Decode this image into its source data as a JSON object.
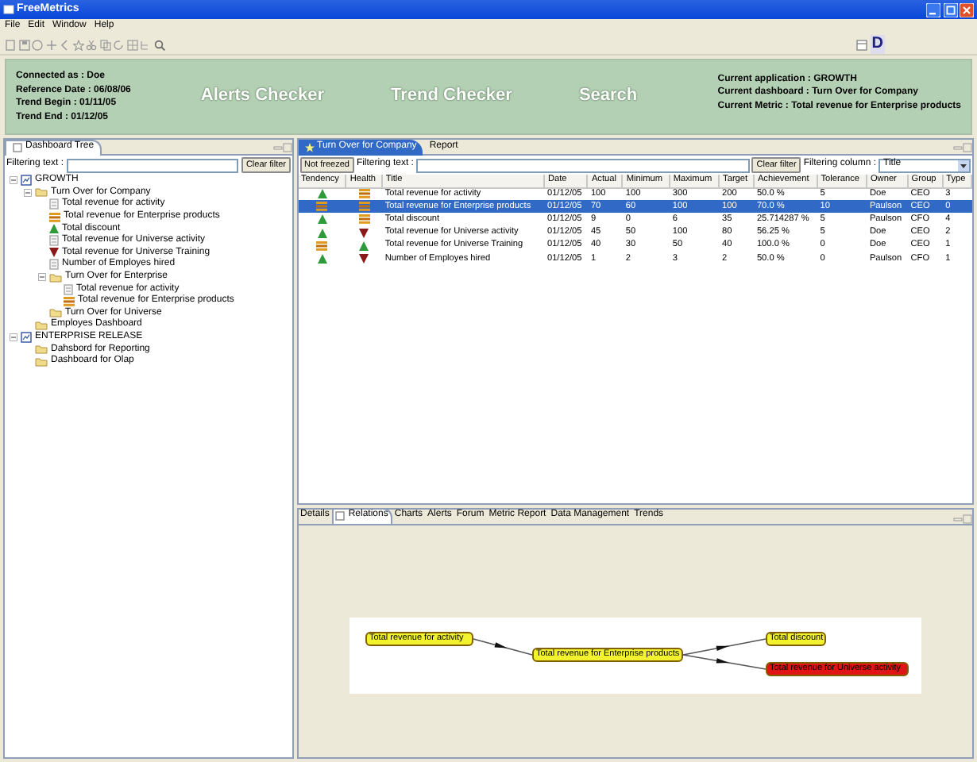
{
  "window": {
    "title": "FreeMetrics"
  },
  "menu": [
    "File",
    "Edit",
    "Window",
    "Help"
  ],
  "toolbar": {
    "logo": "D"
  },
  "header": {
    "info_left": [
      "Connected as : Doe",
      "Reference Date : 06/08/06",
      "Trend Begin : 01/11/05",
      "Trend End : 01/12/05"
    ],
    "links": [
      "Alerts Checker",
      "Trend Checker",
      "Search"
    ],
    "info_right": [
      "Current application : GROWTH",
      "Current dashboard : Turn Over for Company",
      "Current Metric : Total revenue for Enterprise products"
    ]
  },
  "tree_panel": {
    "title": "Dashboard Tree",
    "filter_label": "Filtering text :",
    "clear_button": "Clear filter",
    "items": [
      {
        "label": "GROWTH",
        "kind": "application",
        "expanded": true,
        "children": [
          {
            "label": "Turn Over for Company",
            "kind": "dashboard",
            "expanded": true,
            "children": [
              {
                "label": "Total revenue for activity",
                "kind": "report"
              },
              {
                "label": "Total revenue for Enterprise products",
                "kind": "bars"
              },
              {
                "label": "Total discount",
                "kind": "up"
              },
              {
                "label": "Total revenue for Universe activity",
                "kind": "report"
              },
              {
                "label": "Total revenue for Universe Training",
                "kind": "down"
              },
              {
                "label": "Number of Employes hired",
                "kind": "report"
              },
              {
                "label": "Turn Over for Enterprise",
                "kind": "dashboard",
                "expanded": true,
                "children": [
                  {
                    "label": "Total revenue for activity",
                    "kind": "report"
                  },
                  {
                    "label": "Total revenue for Enterprise products",
                    "kind": "bars"
                  }
                ]
              },
              {
                "label": "Turn Over for Universe",
                "kind": "dashboard"
              }
            ]
          },
          {
            "label": "Employes Dashboard",
            "kind": "dashboard"
          }
        ]
      },
      {
        "label": "ENTERPRISE RELEASE",
        "kind": "application",
        "expanded": true,
        "children": [
          {
            "label": "Dahsbord for Reporting",
            "kind": "dashboard"
          },
          {
            "label": "Dashboard for Olap",
            "kind": "dashboard"
          }
        ]
      }
    ]
  },
  "main_tabs": [
    {
      "label": "Turn Over for Company",
      "selected": true
    },
    {
      "label": "Report",
      "selected": false
    }
  ],
  "table_toolbar": {
    "freeze_button": "Not freezed",
    "filter_label": "Filtering text :",
    "clear_button": "Clear filter",
    "column_label": "Filtering column :",
    "column_value": "Title"
  },
  "table": {
    "icon_columns": [
      "Tendency",
      "Health"
    ],
    "columns": [
      "Title",
      "Date",
      "Actual",
      "Minimum",
      "Maximum",
      "Target",
      "Achievement",
      "Tolerance",
      "Owner",
      "Group",
      "Type"
    ],
    "rows": [
      {
        "tendency": {
          "kind": "up"
        },
        "health": {
          "kind": "bars"
        },
        "selected": false,
        "cells": [
          "Total revenue for activity",
          "01/12/05",
          "100",
          "100",
          "300",
          "200",
          "50.0 %",
          "5",
          "Doe",
          "CEO",
          "3"
        ]
      },
      {
        "tendency": {
          "kind": "bars"
        },
        "health": {
          "kind": "bars"
        },
        "selected": true,
        "cells": [
          "Total revenue for Enterprise products",
          "01/12/05",
          "70",
          "60",
          "100",
          "100",
          "70.0 %",
          "10",
          "Paulson",
          "CEO",
          "0"
        ]
      },
      {
        "tendency": {
          "kind": "up"
        },
        "health": {
          "kind": "bars"
        },
        "selected": false,
        "cells": [
          "Total discount",
          "01/12/05",
          "9",
          "0",
          "6",
          "35",
          "25.714287 %",
          "5",
          "Paulson",
          "CFO",
          "4"
        ]
      },
      {
        "tendency": {
          "kind": "up"
        },
        "health": {
          "kind": "down"
        },
        "selected": false,
        "cells": [
          "Total revenue for Universe activity",
          "01/12/05",
          "45",
          "50",
          "100",
          "80",
          "56.25 %",
          "5",
          "Doe",
          "CEO",
          "2"
        ]
      },
      {
        "tendency": {
          "kind": "bars"
        },
        "health": {
          "kind": "up"
        },
        "selected": false,
        "cells": [
          "Total revenue for Universe Training",
          "01/12/05",
          "40",
          "30",
          "50",
          "40",
          "100.0 %",
          "0",
          "Doe",
          "CEO",
          "1"
        ]
      },
      {
        "tendency": {
          "kind": "up"
        },
        "health": {
          "kind": "down"
        },
        "selected": false,
        "cells": [
          "Number of Employes hired",
          "01/12/05",
          "1",
          "2",
          "3",
          "2",
          "50.0 %",
          "0",
          "Paulson",
          "CFO",
          "1"
        ]
      }
    ]
  },
  "bottom_tabs": [
    {
      "label": "Details",
      "selected": false
    },
    {
      "label": "Relations",
      "selected": true
    },
    {
      "label": "Charts",
      "selected": false
    },
    {
      "label": "Alerts",
      "selected": false
    },
    {
      "label": "Forum",
      "selected": false
    },
    {
      "label": "Metric Report",
      "selected": false
    },
    {
      "label": "Data Management",
      "selected": false
    },
    {
      "label": "Trends",
      "selected": false
    }
  ],
  "relations": {
    "nodes": [
      {
        "label": "Total revenue for activity",
        "color": "#f2f22e"
      },
      {
        "label": "Total revenue for Enterprise products",
        "color": "#f2f22e"
      },
      {
        "label": "Total discount",
        "color": "#f2f22e"
      },
      {
        "label": "Total revenue for Universe activity",
        "color": "#e01414"
      }
    ]
  }
}
